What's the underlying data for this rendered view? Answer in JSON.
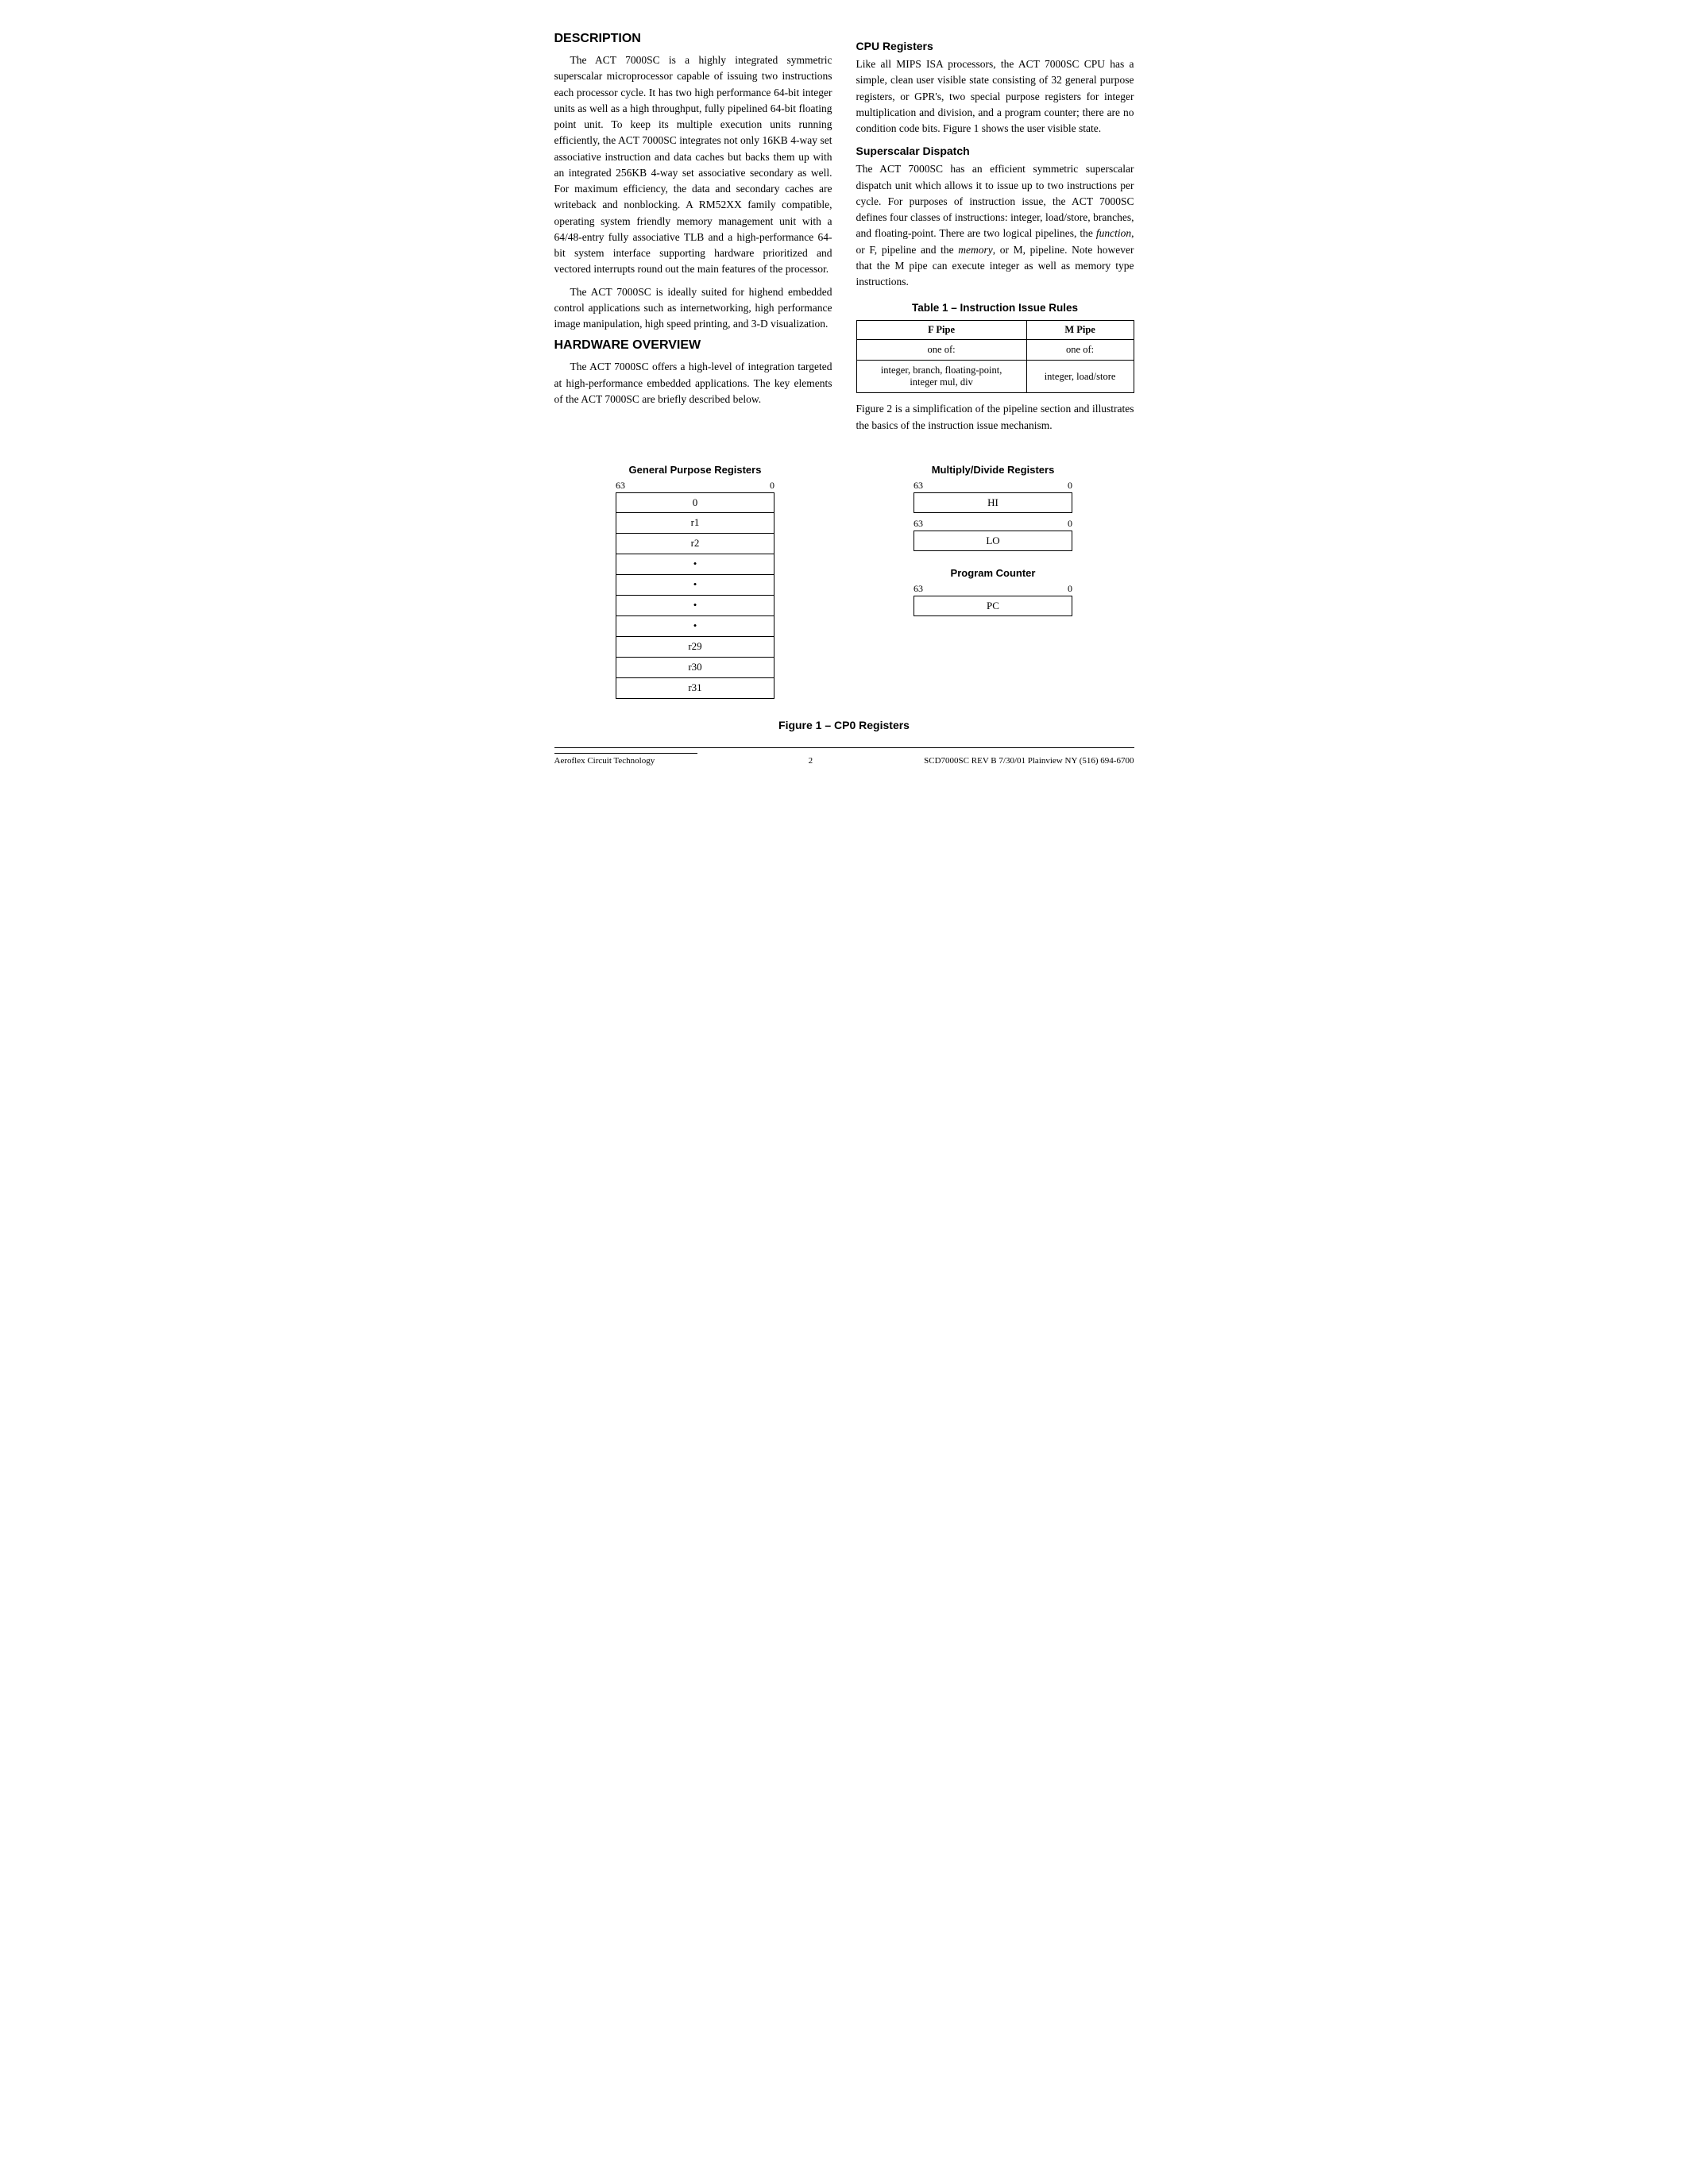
{
  "page": {
    "sections": {
      "description": {
        "title": "DESCRIPTION",
        "para1": "The ACT 7000SC is a highly integrated symmetric superscalar microprocessor capable of issuing two instructions each processor cycle. It has two high performance 64-bit integer units as well as a high throughput, fully pipelined 64-bit floating point unit. To keep its multiple execution units running efficiently, the ACT 7000SC integrates not only 16KB 4-way set associative instruction and data caches but backs them up with an integrated 256KB 4-way set associative secondary as well. For maximum efficiency, the data and secondary caches are writeback and nonblocking. A RM52XX family compatible, operating system friendly memory management unit with a 64/48-entry fully associative TLB and a high-performance 64-bit system interface supporting hardware prioritized and vectored interrupts round out the main features of the processor.",
        "para2": "The ACT 7000SC is ideally suited for highend embedded control applications such as internetworking, high performance image manipulation, high speed printing, and 3-D visualization."
      },
      "hardware_overview": {
        "title": "HARDWARE OVERVIEW",
        "para1": "The ACT 7000SC offers a high-level of integration targeted at high-performance embedded applications. The key elements of the ACT 7000SC are briefly described below."
      },
      "cpu_registers": {
        "title": "CPU Registers",
        "para1": "Like all MIPS ISA processors, the ACT 7000SC CPU has a simple, clean user visible state consisting of 32 general purpose registers, or GPR's, two special purpose registers for integer multiplication and division, and a program counter; there are no condition code bits. Figure 1 shows the user visible state."
      },
      "superscalar_dispatch": {
        "title": "Superscalar Dispatch",
        "para1": "The ACT 7000SC has an efficient symmetric superscalar dispatch unit which allows it to issue up to two instructions per cycle. For purposes of instruction issue, the ACT 7000SC defines four classes of instructions: integer, load/store, branches, and floating-point. There are two logical pipelines, the function, or F, pipeline and the memory, or M, pipeline. Note however that the M pipe can execute integer as well as memory type instructions."
      },
      "table1": {
        "title": "Table 1 – Instruction Issue Rules",
        "headers": [
          "F Pipe",
          "M Pipe"
        ],
        "row1": [
          "one of:",
          "one of:"
        ],
        "row2": [
          "integer, branch, floating-point,\ninteger mul, div",
          "integer, load/store"
        ]
      },
      "figure1_caption": "Figure 1 – CP0 Registers",
      "figure_text": "Figure 2 is a simplification of the pipeline section and illustrates the basics of the instruction issue mechanism."
    },
    "diagrams": {
      "gpr": {
        "title": "General Purpose Registers",
        "bit_high": "63",
        "bit_low": "0",
        "rows": [
          "0",
          "r1",
          "r2",
          "•",
          "•",
          "•",
          "•",
          "r29",
          "r30",
          "r31"
        ]
      },
      "multiply_divide": {
        "title": "Multiply/Divide Registers",
        "bit_high": "63",
        "bit_low": "0",
        "hi_label": "HI",
        "lo_bit_high": "63",
        "lo_bit_low": "0",
        "lo_label": "LO"
      },
      "program_counter": {
        "title": "Program Counter",
        "bit_high": "63",
        "bit_low": "0",
        "pc_label": "PC"
      }
    },
    "footer": {
      "left": "Aeroflex Circuit Technology",
      "center": "2",
      "right": "SCD7000SC REV B  7/30/01  Plainview NY (516) 694-6700"
    }
  }
}
